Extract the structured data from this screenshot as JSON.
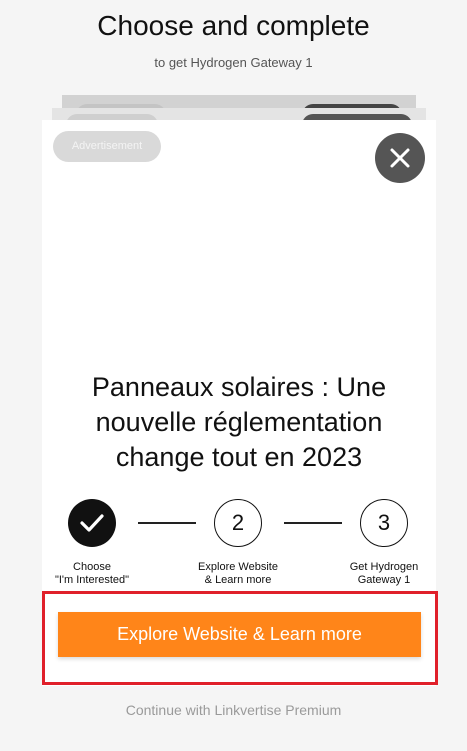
{
  "header": {
    "title": "Choose and complete",
    "subtitle": "to get Hydrogen Gateway 1"
  },
  "card": {
    "ad_badge": "Advertisement",
    "close_icon": "close-icon",
    "headline": "Panneaux solaires : Une nouvelle réglementation change tout en 2023"
  },
  "steps": [
    {
      "marker": "check-icon",
      "label": "Choose\n\"I'm Interested\""
    },
    {
      "marker": "2",
      "label": "Explore Website\n& Learn more"
    },
    {
      "marker": "3",
      "label": "Get Hydrogen\nGateway 1"
    }
  ],
  "cta": {
    "label": "Explore Website & Learn more"
  },
  "footer": {
    "premium_link": "Continue with Linkvertise Premium"
  },
  "colors": {
    "accent": "#ff8519",
    "highlight_border": "#e0202a",
    "close_bg": "#555555"
  }
}
